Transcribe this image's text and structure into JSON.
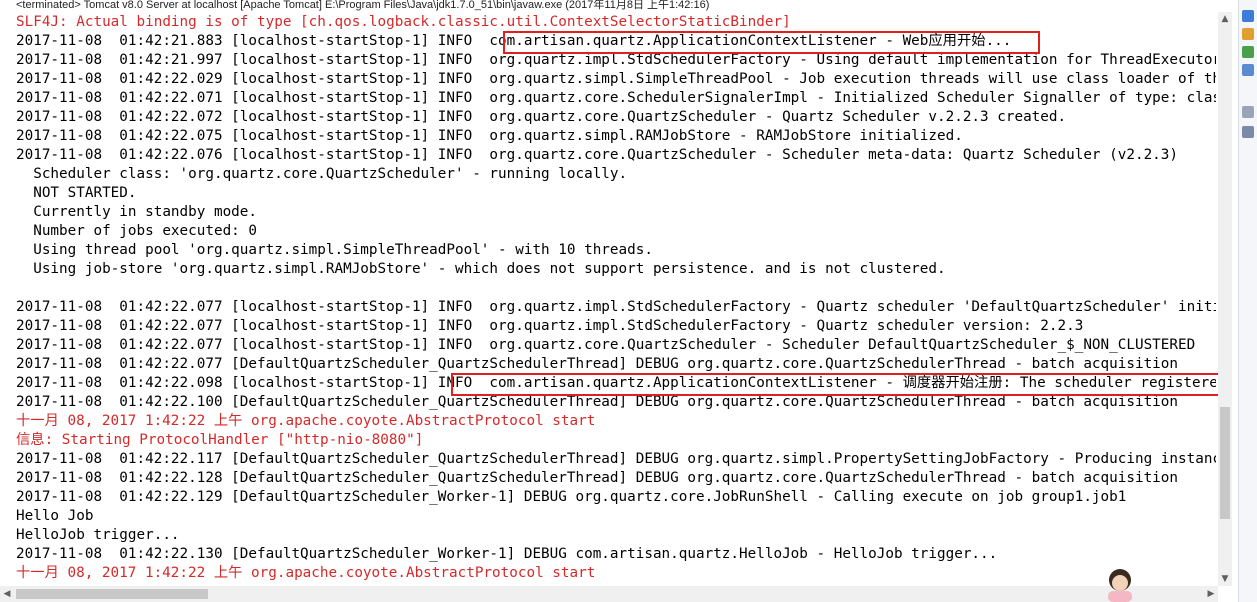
{
  "window": {
    "title": "<terminated> Tomcat v8.0 Server at localhost [Apache Tomcat] E:\\Program Files\\Java\\jdk1.7.0_51\\bin\\javaw.exe (2017年11月8日 上午1:42:16)"
  },
  "console": {
    "lines": [
      {
        "text": "SLF4J: Actual binding is of type [ch.qos.logback.classic.util.ContextSelectorStaticBinder]",
        "color": "red"
      },
      {
        "text": "2017-11-08  01:42:21.883 [localhost-startStop-1] INFO  com.artisan.quartz.ApplicationContextListener - Web应用开始...",
        "color": "black"
      },
      {
        "text": "2017-11-08  01:42:21.997 [localhost-startStop-1] INFO  org.quartz.impl.StdSchedulerFactory - Using default implementation for ThreadExecutor",
        "color": "black"
      },
      {
        "text": "2017-11-08  01:42:22.029 [localhost-startStop-1] INFO  org.quartz.simpl.SimpleThreadPool - Job execution threads will use class loader of thread",
        "color": "black"
      },
      {
        "text": "2017-11-08  01:42:22.071 [localhost-startStop-1] INFO  org.quartz.core.SchedulerSignalerImpl - Initialized Scheduler Signaller of type: class",
        "color": "black"
      },
      {
        "text": "2017-11-08  01:42:22.072 [localhost-startStop-1] INFO  org.quartz.core.QuartzScheduler - Quartz Scheduler v.2.2.3 created.",
        "color": "black"
      },
      {
        "text": "2017-11-08  01:42:22.075 [localhost-startStop-1] INFO  org.quartz.simpl.RAMJobStore - RAMJobStore initialized.",
        "color": "black"
      },
      {
        "text": "2017-11-08  01:42:22.076 [localhost-startStop-1] INFO  org.quartz.core.QuartzScheduler - Scheduler meta-data: Quartz Scheduler (v2.2.3)",
        "color": "black"
      },
      {
        "text": "  Scheduler class: 'org.quartz.core.QuartzScheduler' - running locally.",
        "color": "black"
      },
      {
        "text": "  NOT STARTED.",
        "color": "black"
      },
      {
        "text": "  Currently in standby mode.",
        "color": "black"
      },
      {
        "text": "  Number of jobs executed: 0",
        "color": "black"
      },
      {
        "text": "  Using thread pool 'org.quartz.simpl.SimpleThreadPool' - with 10 threads.",
        "color": "black"
      },
      {
        "text": "  Using job-store 'org.quartz.simpl.RAMJobStore' - which does not support persistence. and is not clustered.",
        "color": "black"
      },
      {
        "text": "",
        "color": "black"
      },
      {
        "text": "2017-11-08  01:42:22.077 [localhost-startStop-1] INFO  org.quartz.impl.StdSchedulerFactory - Quartz scheduler 'DefaultQuartzScheduler' initialized",
        "color": "black"
      },
      {
        "text": "2017-11-08  01:42:22.077 [localhost-startStop-1] INFO  org.quartz.impl.StdSchedulerFactory - Quartz scheduler version: 2.2.3",
        "color": "black"
      },
      {
        "text": "2017-11-08  01:42:22.077 [localhost-startStop-1] INFO  org.quartz.core.QuartzScheduler - Scheduler DefaultQuartzScheduler_$_NON_CLUSTERED",
        "color": "black"
      },
      {
        "text": "2017-11-08  01:42:22.077 [DefaultQuartzScheduler_QuartzSchedulerThread] DEBUG org.quartz.core.QuartzSchedulerThread - batch acquisition",
        "color": "black"
      },
      {
        "text": "2017-11-08  01:42:22.098 [localhost-startStop-1] INFO  com.artisan.quartz.ApplicationContextListener - 调度器开始注册: The scheduler registered",
        "color": "black"
      },
      {
        "text": "2017-11-08  01:42:22.100 [DefaultQuartzScheduler_QuartzSchedulerThread] DEBUG org.quartz.core.QuartzSchedulerThread - batch acquisition",
        "color": "black"
      },
      {
        "text": "十一月 08, 2017 1:42:22 上午 org.apache.coyote.AbstractProtocol start",
        "color": "red"
      },
      {
        "text": "信息: Starting ProtocolHandler [\"http-nio-8080\"]",
        "color": "red"
      },
      {
        "text": "2017-11-08  01:42:22.117 [DefaultQuartzScheduler_QuartzSchedulerThread] DEBUG org.quartz.simpl.PropertySettingJobFactory - Producing instance",
        "color": "black"
      },
      {
        "text": "2017-11-08  01:42:22.128 [DefaultQuartzScheduler_QuartzSchedulerThread] DEBUG org.quartz.core.QuartzSchedulerThread - batch acquisition",
        "color": "black"
      },
      {
        "text": "2017-11-08  01:42:22.129 [DefaultQuartzScheduler_Worker-1] DEBUG org.quartz.core.JobRunShell - Calling execute on job group1.job1",
        "color": "black"
      },
      {
        "text": "Hello Job",
        "color": "black"
      },
      {
        "text": "HelloJob trigger...",
        "color": "black"
      },
      {
        "text": "2017-11-08  01:42:22.130 [DefaultQuartzScheduler_Worker-1] DEBUG com.artisan.quartz.HelloJob - HelloJob trigger...",
        "color": "black"
      },
      {
        "text": "十一月 08, 2017 1:42:22 上午 org.apache.coyote.AbstractProtocol start",
        "color": "red"
      }
    ]
  },
  "colors": {
    "error_text": "#d42a2a",
    "highlight_border": "#e02020"
  }
}
